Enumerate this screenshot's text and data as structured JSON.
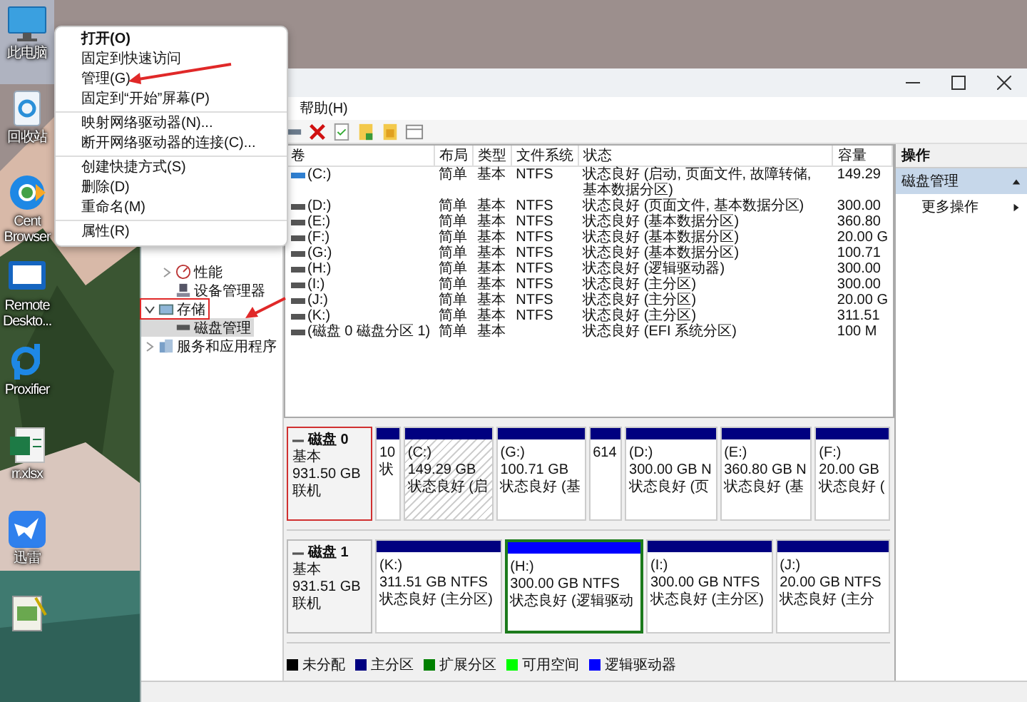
{
  "desktop_icons": [
    {
      "label": "此电脑",
      "selected": true
    },
    {
      "label": "回收站",
      "selected": false
    },
    {
      "label": "Cent Browser",
      "selected": false
    },
    {
      "label": "Remote Deskto...",
      "selected": false
    },
    {
      "label": "Proxifier",
      "selected": false
    },
    {
      "label": "rr.xlsx",
      "selected": false
    },
    {
      "label": "迅雷",
      "selected": false
    }
  ],
  "context_menu": {
    "groups": [
      [
        {
          "label": "打开(O)",
          "default": true
        },
        {
          "label": "固定到快速访问",
          "default": false
        },
        {
          "label": "管理(G)",
          "default": false
        },
        {
          "label": "固定到“开始”屏幕(P)",
          "default": false
        }
      ],
      [
        {
          "label": "映射网络驱动器(N)...",
          "default": false
        },
        {
          "label": "断开网络驱动器的连接(C)...",
          "default": false
        }
      ],
      [
        {
          "label": "创建快捷方式(S)",
          "default": false
        },
        {
          "label": "删除(D)",
          "default": false
        },
        {
          "label": "重命名(M)",
          "default": false
        }
      ],
      [
        {
          "label": "属性(R)",
          "default": false
        }
      ]
    ]
  },
  "menu_bar": [
    "帮助(H)"
  ],
  "tree": [
    {
      "children": [
        {
          "label": "性能",
          "expanded": false,
          "selected": false
        },
        {
          "label": "设备管理器",
          "selected": false
        }
      ]
    },
    {
      "label": "存储",
      "expanded": true,
      "selected": false,
      "annotated": true,
      "children": [
        {
          "label": "磁盘管理",
          "selected": true,
          "annotated": false
        }
      ]
    },
    {
      "label": "服务和应用程序",
      "expanded": false,
      "selected": false
    }
  ],
  "volumes": {
    "columns": [
      "卷",
      "布局",
      "类型",
      "文件系统",
      "状态",
      "容量"
    ],
    "rows": [
      {
        "volume": "(C:)",
        "layout": "简单",
        "type": "基本",
        "file_system": "NTFS",
        "status": "状态良好 (启动, 页面文件, 故障转储, 基本数据分区)",
        "capacity": "149.29"
      },
      {
        "volume": "(D:)",
        "layout": "简单",
        "type": "基本",
        "file_system": "NTFS",
        "status": "状态良好 (页面文件, 基本数据分区)",
        "capacity": "300.00"
      },
      {
        "volume": "(E:)",
        "layout": "简单",
        "type": "基本",
        "file_system": "NTFS",
        "status": "状态良好 (基本数据分区)",
        "capacity": "360.80"
      },
      {
        "volume": "(F:)",
        "layout": "简单",
        "type": "基本",
        "file_system": "NTFS",
        "status": "状态良好 (基本数据分区)",
        "capacity": "20.00 G"
      },
      {
        "volume": "(G:)",
        "layout": "简单",
        "type": "基本",
        "file_system": "NTFS",
        "status": "状态良好 (基本数据分区)",
        "capacity": "100.71"
      },
      {
        "volume": "(H:)",
        "layout": "简单",
        "type": "基本",
        "file_system": "NTFS",
        "status": "状态良好 (逻辑驱动器)",
        "capacity": "300.00"
      },
      {
        "volume": "(I:)",
        "layout": "简单",
        "type": "基本",
        "file_system": "NTFS",
        "status": "状态良好 (主分区)",
        "capacity": "300.00"
      },
      {
        "volume": "(J:)",
        "layout": "简单",
        "type": "基本",
        "file_system": "NTFS",
        "status": "状态良好 (主分区)",
        "capacity": "20.00 G"
      },
      {
        "volume": "(K:)",
        "layout": "简单",
        "type": "基本",
        "file_system": "NTFS",
        "status": "状态良好 (主分区)",
        "capacity": "311.51"
      },
      {
        "volume": "(磁盘 0 磁盘分区 1)",
        "layout": "简单",
        "type": "基本",
        "status": "状态良好 (EFI 系统分区)",
        "capacity": "100 M"
      }
    ]
  },
  "disks": [
    {
      "name": "磁盘 0",
      "type": "基本",
      "size": "931.50 GB",
      "state": "联机",
      "annotated": true,
      "partitions": [
        {
          "kind": "primary",
          "selected": false,
          "size": "10",
          "status": "状"
        },
        {
          "kind": "primary",
          "selected": true,
          "label": "(C:)",
          "size": "149.29 GB",
          "status": "状态良好 (启"
        },
        {
          "kind": "primary",
          "selected": false,
          "label": "(G:)",
          "size": "100.71 GB",
          "status": "状态良好 (基"
        },
        {
          "kind": "primary",
          "selected": false,
          "size": "614"
        },
        {
          "kind": "primary",
          "selected": false,
          "label": "(D:)",
          "size": "300.00 GB N",
          "status": "状态良好 (页"
        },
        {
          "kind": "primary",
          "selected": false,
          "label": "(E:)",
          "size": "360.80 GB N",
          "status": "状态良好 (基"
        },
        {
          "kind": "primary",
          "selected": false,
          "label": "(F:)",
          "size": "20.00 GB",
          "status": "状态良好 ("
        }
      ]
    },
    {
      "name": "磁盘 1",
      "type": "基本",
      "size": "931.51 GB",
      "state": "联机",
      "annotated": false,
      "partitions": [
        {
          "kind": "primary",
          "selected": false,
          "label": "(K:)",
          "size": "311.51 GB NTFS",
          "status": "状态良好 (主分区)"
        },
        {
          "kind": "logical",
          "selected": false,
          "label": "(H:)",
          "size": "300.00 GB NTFS",
          "status": "状态良好 (逻辑驱动"
        },
        {
          "kind": "primary",
          "selected": false,
          "label": "(I:)",
          "size": "300.00 GB NTFS",
          "status": "状态良好 (主分区)"
        },
        {
          "kind": "primary",
          "selected": false,
          "label": "(J:)",
          "size": "20.00 GB NTFS",
          "status": "状态良好 (主分"
        }
      ]
    }
  ],
  "legend": [
    {
      "label": "未分配",
      "color": "#000000"
    },
    {
      "label": "主分区",
      "color": "#000080"
    },
    {
      "label": "扩展分区",
      "color": "#008000"
    },
    {
      "label": "可用空间",
      "color": "#00ff00"
    },
    {
      "label": "逻辑驱动器",
      "color": "#0000ff"
    }
  ],
  "actions": {
    "title": "操作",
    "sections": [
      {
        "label": "磁盘管理",
        "expanded": true,
        "items": [
          "更多操作"
        ]
      }
    ]
  }
}
